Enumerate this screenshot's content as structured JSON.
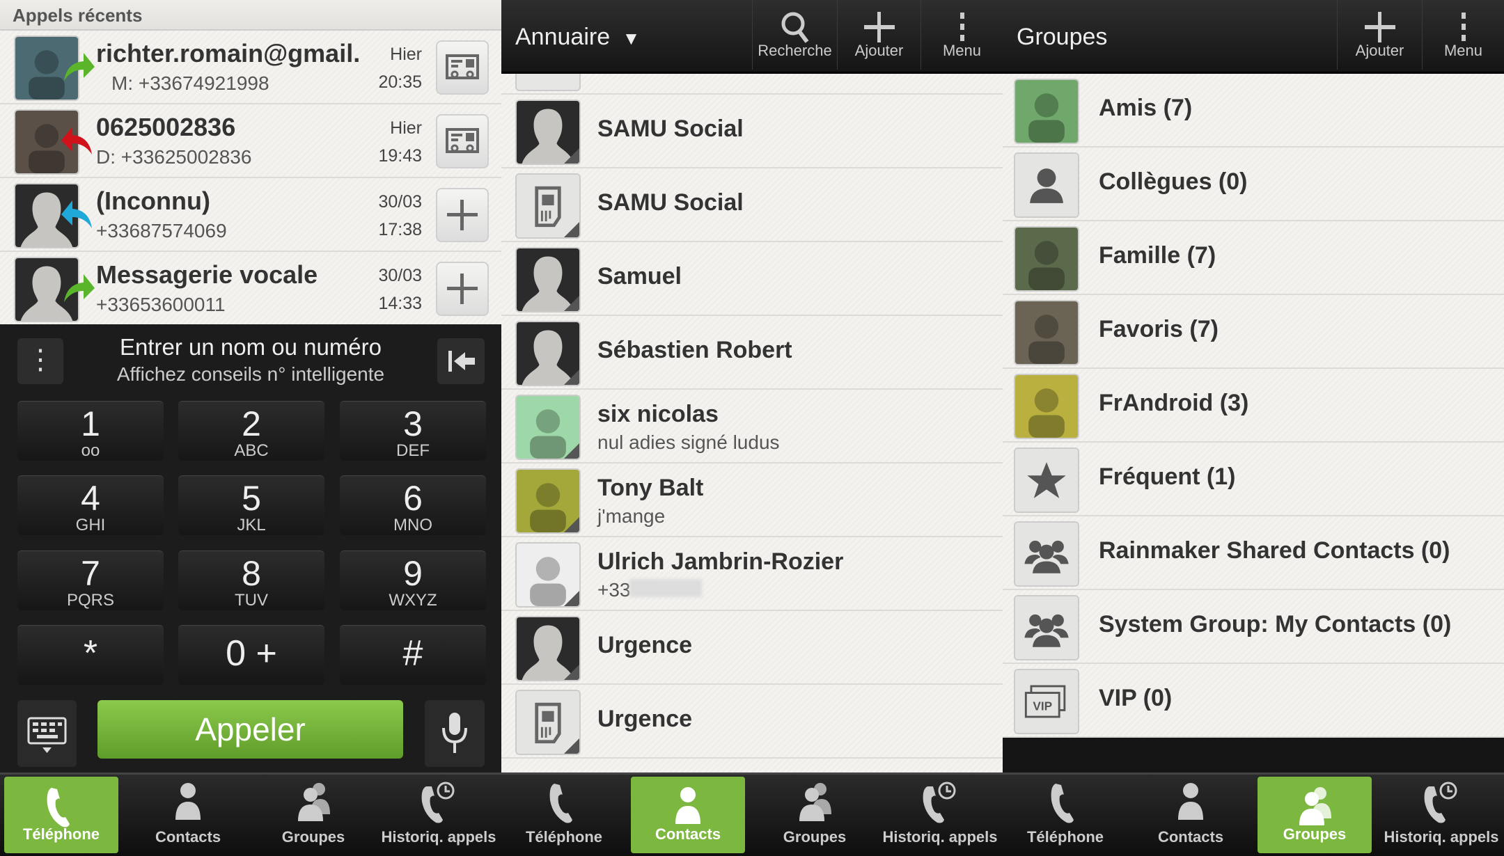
{
  "colors": {
    "accent_green": "#7cb83f",
    "outgoing_arrow": "#5bb52a",
    "missed_arrow": "#d0121b",
    "incoming_arrow": "#1fa8d8"
  },
  "phone": {
    "recent_title": "Appels récents",
    "calls": [
      {
        "name": "richter.romain@gmail.co",
        "detail": "M: +33674921998",
        "day": "Hier",
        "time": "20:35",
        "type": "outgoing",
        "action_icon": "contact-card-icon",
        "avatar": "photo"
      },
      {
        "name": "0625002836",
        "detail": "D: +33625002836",
        "day": "Hier",
        "time": "19:43",
        "type": "missed",
        "action_icon": "contact-card-icon",
        "avatar": "photo"
      },
      {
        "name": "(Inconnu)",
        "detail": "+33687574069",
        "day": "30/03",
        "time": "17:38",
        "type": "incoming",
        "action_icon": "plus-icon",
        "avatar": "silhouette"
      },
      {
        "name": "Messagerie vocale",
        "detail": "+33653600011",
        "day": "30/03",
        "time": "14:33",
        "type": "outgoing",
        "action_icon": "plus-icon",
        "avatar": "silhouette"
      }
    ],
    "input_placeholder": "Entrer un nom ou numéro",
    "input_hint": "Affichez conseils n° intelligente",
    "keys": [
      {
        "d": "1",
        "l": "oo"
      },
      {
        "d": "2",
        "l": "ABC"
      },
      {
        "d": "3",
        "l": "DEF"
      },
      {
        "d": "4",
        "l": "GHI"
      },
      {
        "d": "5",
        "l": "JKL"
      },
      {
        "d": "6",
        "l": "MNO"
      },
      {
        "d": "7",
        "l": "PQRS"
      },
      {
        "d": "8",
        "l": "TUV"
      },
      {
        "d": "9",
        "l": "WXYZ"
      },
      {
        "d": "*",
        "l": ""
      },
      {
        "d": "0 +",
        "l": ""
      },
      {
        "d": "#",
        "l": ""
      }
    ],
    "call_label": "Appeler"
  },
  "contacts": {
    "title": "Annuaire",
    "actions": [
      "Recherche",
      "Ajouter",
      "Menu"
    ],
    "items": [
      {
        "name": "SAMU Social",
        "sub": "",
        "avatar": "silhouette"
      },
      {
        "name": "SAMU Social",
        "sub": "",
        "avatar": "sim"
      },
      {
        "name": "Samuel",
        "sub": "",
        "avatar": "silhouette"
      },
      {
        "name": "Sébastien Robert",
        "sub": "",
        "avatar": "silhouette"
      },
      {
        "name": "six nicolas",
        "sub": "nul adies signé ludus",
        "avatar": "photo"
      },
      {
        "name": "Tony Balt",
        "sub": "j'mange",
        "avatar": "photo"
      },
      {
        "name": "Ulrich Jambrin-Rozier",
        "sub": "+33",
        "avatar": "photo"
      },
      {
        "name": "Urgence",
        "sub": "",
        "avatar": "silhouette"
      },
      {
        "name": "Urgence",
        "sub": "",
        "avatar": "sim"
      }
    ]
  },
  "groups": {
    "title": "Groupes",
    "actions": [
      "Ajouter",
      "Menu"
    ],
    "items": [
      {
        "name": "Amis (7)",
        "icon": "photo"
      },
      {
        "name": "Collègues (0)",
        "icon": "person"
      },
      {
        "name": "Famille (7)",
        "icon": "photo"
      },
      {
        "name": "Favoris (7)",
        "icon": "photo"
      },
      {
        "name": "FrAndroid (3)",
        "icon": "photo"
      },
      {
        "name": "Fréquent (1)",
        "icon": "star"
      },
      {
        "name": "Rainmaker Shared Contacts (0)",
        "icon": "people"
      },
      {
        "name": "System Group: My Contacts (0)",
        "icon": "people"
      },
      {
        "name": "VIP (0)",
        "icon": "vip"
      }
    ]
  },
  "bottom_nav": [
    {
      "label": "Téléphone",
      "icon": "phone-icon",
      "active": true
    },
    {
      "label": "Contacts",
      "icon": "person-icon",
      "active": false
    },
    {
      "label": "Groupes",
      "icon": "group-icon",
      "active": false
    },
    {
      "label": "Historiq. appels",
      "icon": "call-history-icon",
      "active": false
    },
    {
      "label": "Téléphone",
      "icon": "phone-icon",
      "active": false
    },
    {
      "label": "Contacts",
      "icon": "person-icon",
      "active": true
    },
    {
      "label": "Groupes",
      "icon": "group-icon",
      "active": false
    },
    {
      "label": "Historiq. appels",
      "icon": "call-history-icon",
      "active": false
    },
    {
      "label": "Téléphone",
      "icon": "phone-icon",
      "active": false
    },
    {
      "label": "Contacts",
      "icon": "person-icon",
      "active": false
    },
    {
      "label": "Groupes",
      "icon": "group-icon",
      "active": true
    },
    {
      "label": "Historiq. appels",
      "icon": "call-history-icon",
      "active": false
    }
  ]
}
